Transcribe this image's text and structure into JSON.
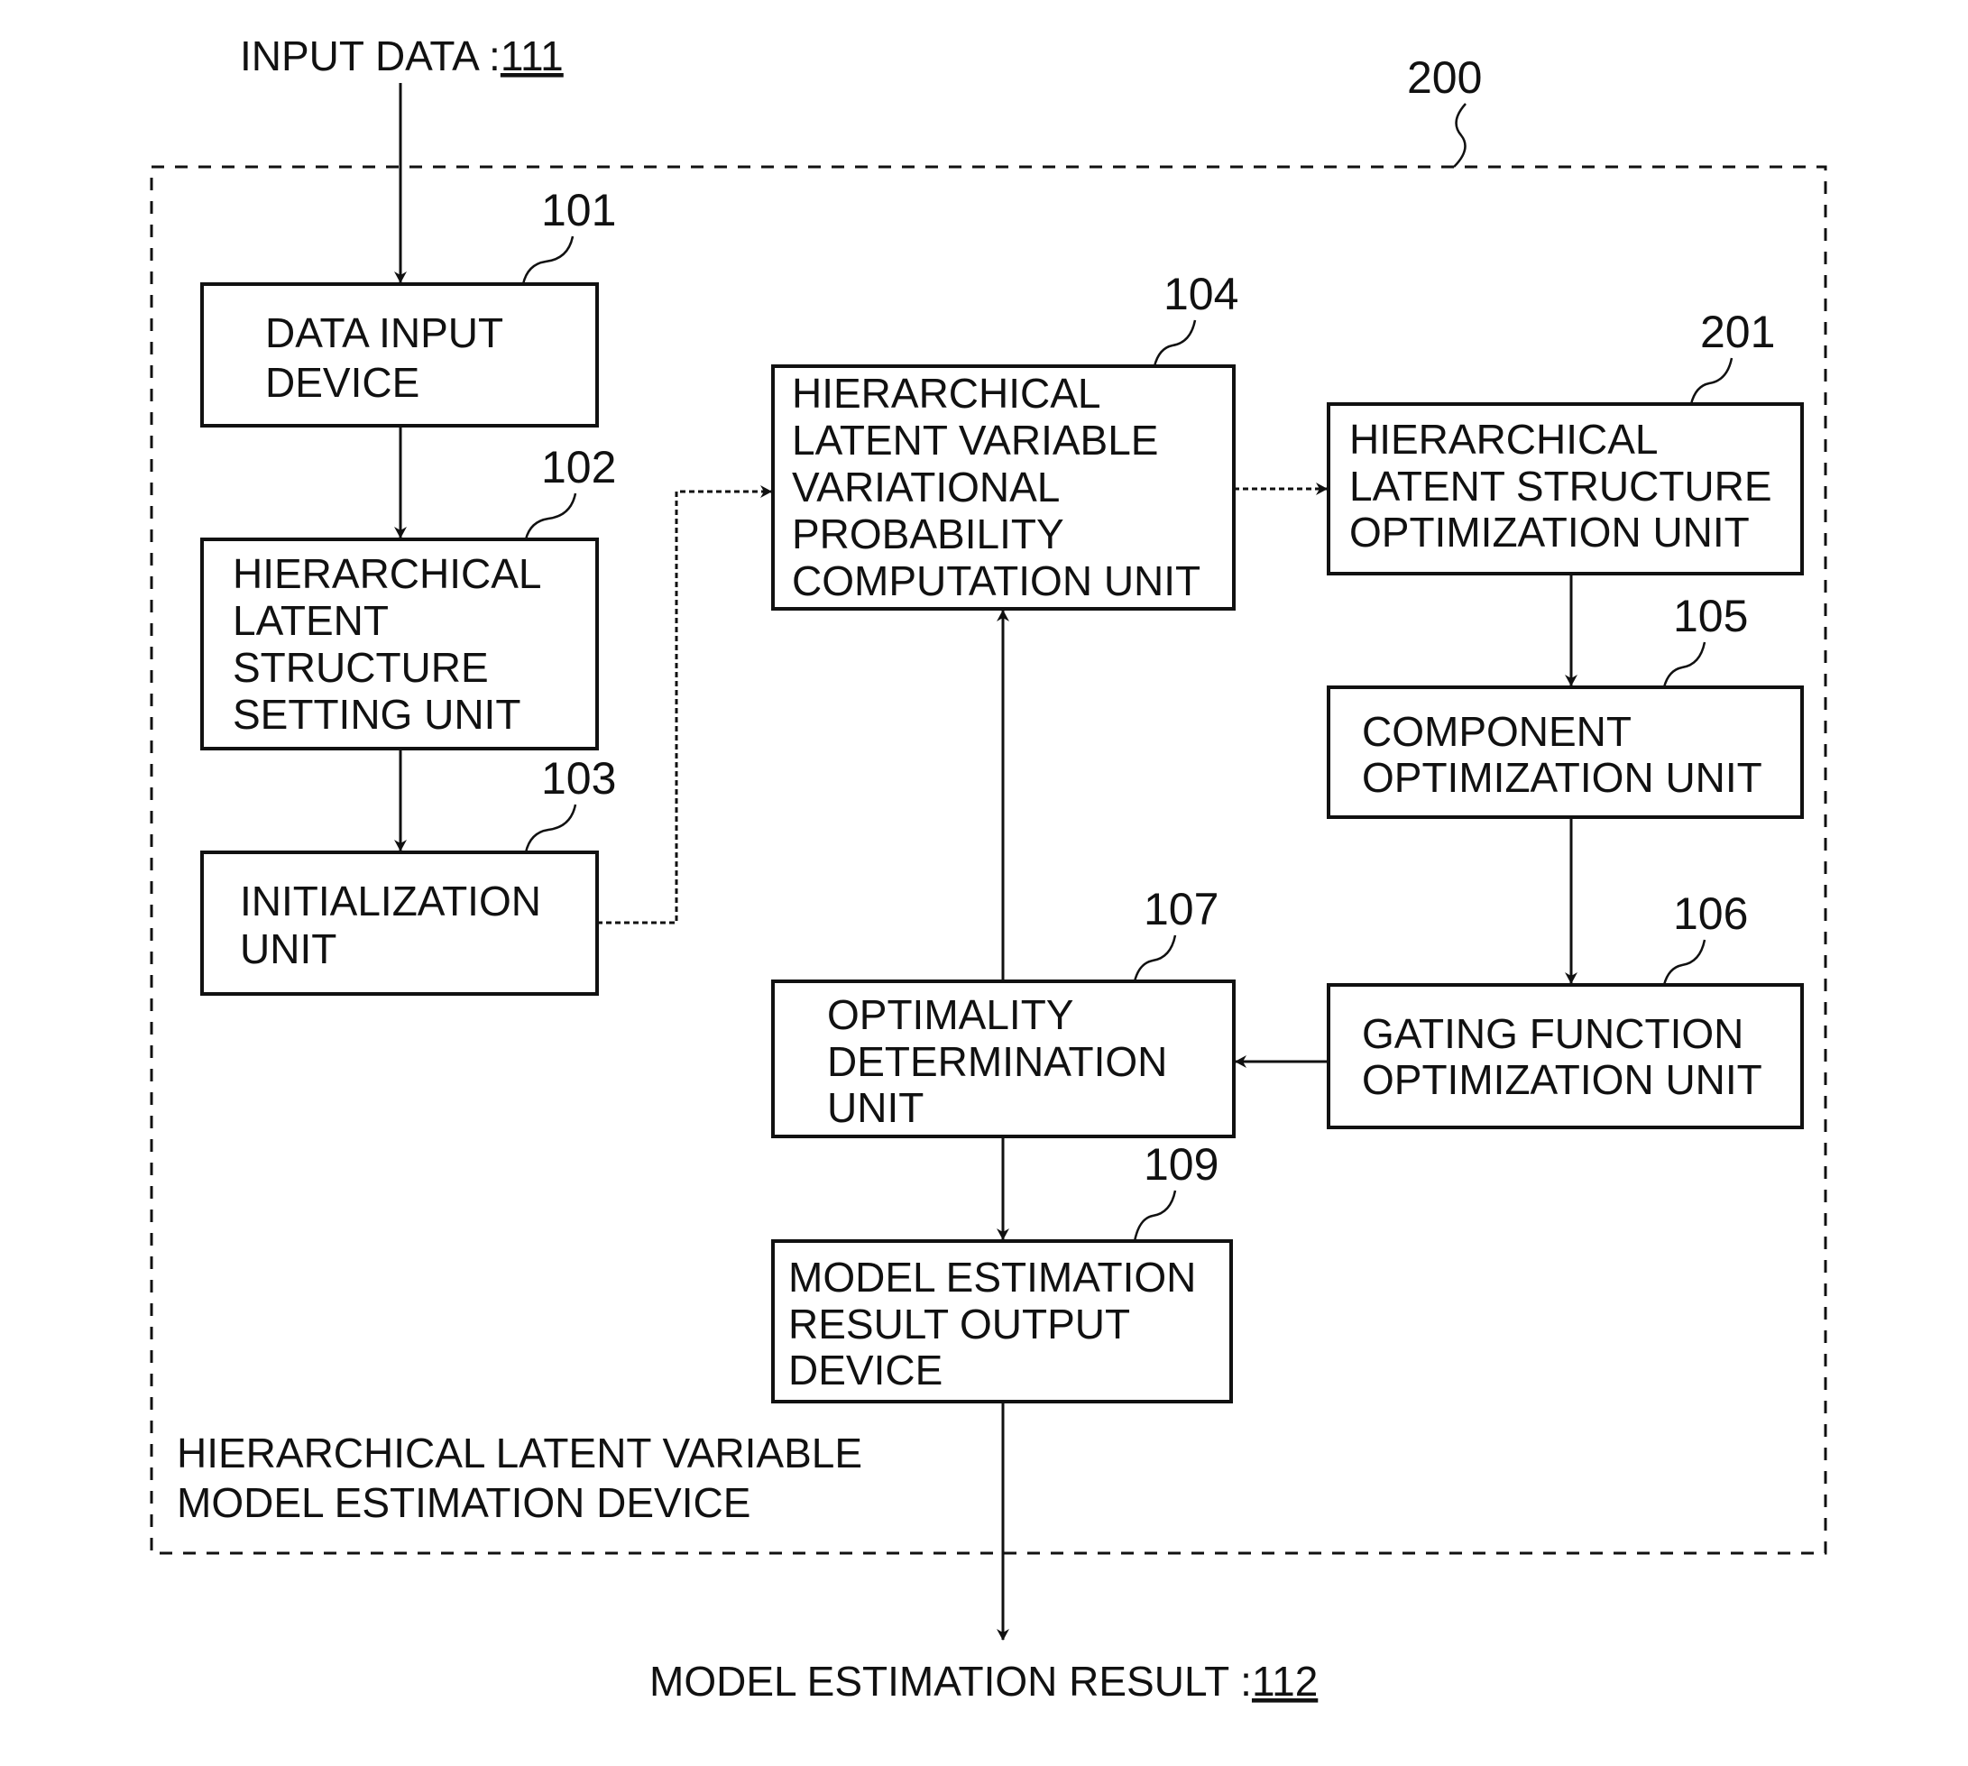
{
  "diagram": {
    "input_label": "INPUT DATA :",
    "input_ref": "111",
    "output_label": "MODEL ESTIMATION RESULT :",
    "output_ref": "112",
    "outer_ref": "200",
    "device_label": [
      "HIERARCHICAL LATENT VARIABLE",
      "MODEL ESTIMATION DEVICE"
    ],
    "blocks": {
      "b101": {
        "ref": "101",
        "lines": [
          "DATA INPUT",
          "DEVICE"
        ]
      },
      "b102": {
        "ref": "102",
        "lines": [
          "HIERARCHICAL",
          "LATENT",
          "STRUCTURE",
          "SETTING UNIT"
        ]
      },
      "b103": {
        "ref": "103",
        "lines": [
          "INITIALIZATION",
          "UNIT"
        ]
      },
      "b104": {
        "ref": "104",
        "lines": [
          "HIERARCHICAL",
          "LATENT VARIABLE",
          "VARIATIONAL",
          "PROBABILITY",
          "COMPUTATION UNIT"
        ]
      },
      "b201": {
        "ref": "201",
        "lines": [
          "HIERARCHICAL",
          "LATENT STRUCTURE",
          "OPTIMIZATION UNIT"
        ]
      },
      "b105": {
        "ref": "105",
        "lines": [
          "COMPONENT",
          "OPTIMIZATION UNIT"
        ]
      },
      "b106": {
        "ref": "106",
        "lines": [
          "GATING FUNCTION",
          "OPTIMIZATION UNIT"
        ]
      },
      "b107": {
        "ref": "107",
        "lines": [
          "OPTIMALITY",
          "DETERMINATION",
          "UNIT"
        ]
      },
      "b109": {
        "ref": "109",
        "lines": [
          "MODEL ESTIMATION",
          "RESULT OUTPUT",
          "DEVICE"
        ]
      }
    },
    "edges": [
      {
        "from": "input",
        "to": "b101"
      },
      {
        "from": "b101",
        "to": "b102"
      },
      {
        "from": "b102",
        "to": "b103"
      },
      {
        "from": "b103",
        "to": "b104"
      },
      {
        "from": "b104",
        "to": "b201"
      },
      {
        "from": "b201",
        "to": "b105"
      },
      {
        "from": "b105",
        "to": "b106"
      },
      {
        "from": "b106",
        "to": "b107"
      },
      {
        "from": "b107",
        "to": "b104"
      },
      {
        "from": "b107",
        "to": "b109"
      },
      {
        "from": "b109",
        "to": "output"
      }
    ]
  }
}
